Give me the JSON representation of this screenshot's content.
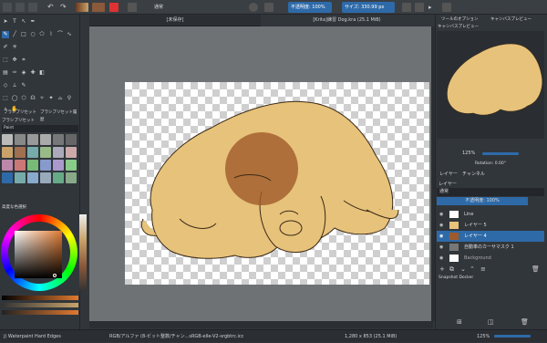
{
  "toolbar": {
    "blend_mode": "通常",
    "opacity_label": "不透明度: 100%",
    "size_label": "サイズ: 330.99 px"
  },
  "left_docker": {
    "brush_presets_title": "ブラシプリセット",
    "brush_tab_1": "ブラシプリセット",
    "brush_tab_2": "ブラシプリセット履歴",
    "brush_preset_header": "ブラシプリセット",
    "brush_tag": "Paint",
    "color_panel_title": "高度な色選択"
  },
  "tabs": [
    {
      "label": "[未保存]"
    },
    {
      "label": "[Krita]練習 Dog.kra (25.1 MiB)"
    }
  ],
  "right_docker": {
    "tab_overview": "ツールのオプション",
    "tab_canvas_preview": "キャンバスプレビュー",
    "preview_title": "キャンバスプレビュー",
    "zoom_label": "125%",
    "rotation_label": "Rotation: 0.00°",
    "layers_tab": "レイヤー",
    "channels_tab": "チャンネル",
    "layers_title": "レイヤー",
    "layer_blend": "通常",
    "layer_opacity": "不透明度: 100%",
    "layers": [
      {
        "name": "Line",
        "selected": false
      },
      {
        "name": "レイヤー 5",
        "selected": false
      },
      {
        "name": "レイヤー 4",
        "selected": true
      },
      {
        "name": "自動車のカーサマスク 1",
        "selected": false
      },
      {
        "name": "Background",
        "selected": false
      }
    ],
    "snapshot_title": "Snapshot Docker"
  },
  "status": {
    "brush_name": "j) Waterpaint Hard Edges",
    "color_profile": "RGB/アルファ (8-ビット整数/チャン...sRGB-elle-V2-srgbtrc.icc",
    "image_size": "1,280 x 853 (25.1 MiB)",
    "zoom": "125%"
  },
  "colors": {
    "accent": "#2e6aa8",
    "dog_fill": "#e7c27a",
    "dog_stroke": "#3a2a18",
    "watercolor": "#a05a2a"
  }
}
